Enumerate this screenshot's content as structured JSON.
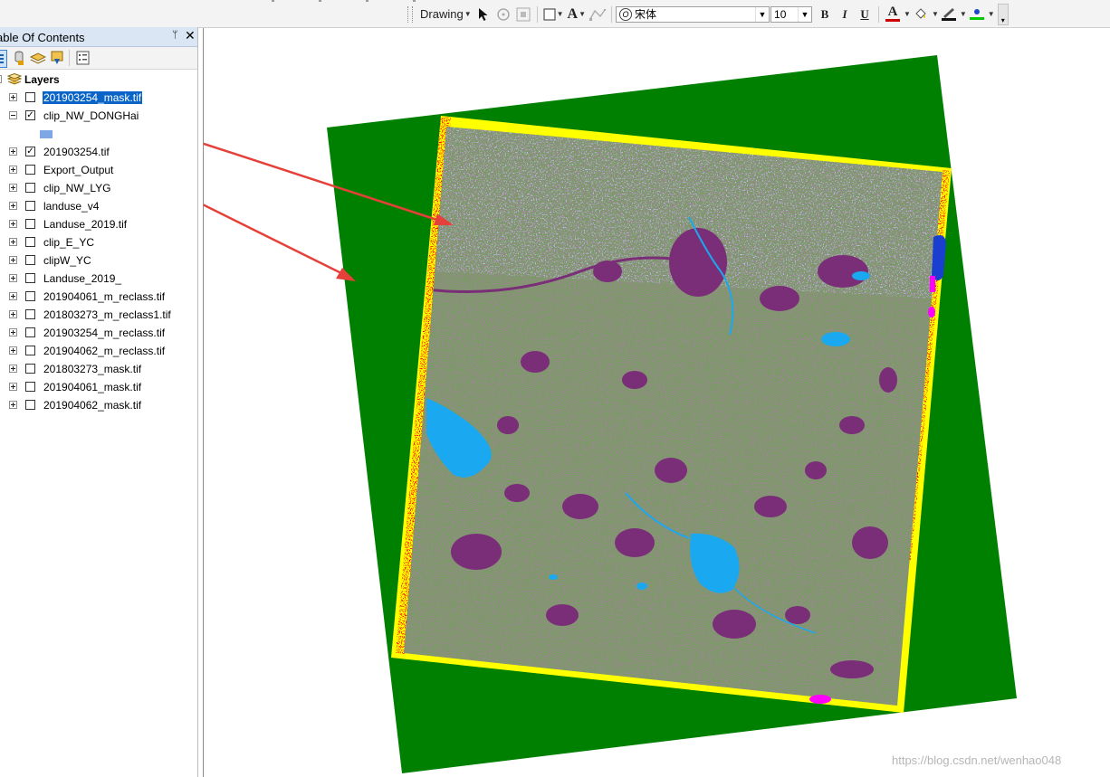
{
  "toolbar": {
    "drawing_label": "Drawing",
    "font_name": "宋体",
    "font_size": "10",
    "bold_label": "B",
    "italic_label": "I",
    "underline_label": "U",
    "font_color_label": "A",
    "text_tool_label": "A",
    "colors": {
      "font": "#cc0000",
      "fill": "#e8c300",
      "line": "#00cc00"
    }
  },
  "toc": {
    "title": "able Of Contents",
    "pin_glyph": "ᛘ",
    "close_glyph": "✕",
    "root_label": "Layers",
    "layers": [
      {
        "name": "201903254_mask.tif",
        "checked": false,
        "expanded": false,
        "selected": true
      },
      {
        "name": "clip_NW_DONGHai",
        "checked": true,
        "expanded": true,
        "selected": false,
        "legend_color": "#7ea7e6"
      },
      {
        "name": "201903254.tif",
        "checked": true,
        "expanded": false,
        "selected": false
      },
      {
        "name": "Export_Output",
        "checked": false,
        "expanded": false,
        "selected": false
      },
      {
        "name": "clip_NW_LYG",
        "checked": false,
        "expanded": false,
        "selected": false
      },
      {
        "name": "landuse_v4",
        "checked": false,
        "expanded": false,
        "selected": false
      },
      {
        "name": "Landuse_2019.tif",
        "checked": false,
        "expanded": false,
        "selected": false
      },
      {
        "name": "clip_E_YC",
        "checked": false,
        "expanded": false,
        "selected": false
      },
      {
        "name": "clipW_YC",
        "checked": false,
        "expanded": false,
        "selected": false
      },
      {
        "name": "Landuse_2019_",
        "checked": false,
        "expanded": false,
        "selected": false
      },
      {
        "name": "201904061_m_reclass.tif",
        "checked": false,
        "expanded": false,
        "selected": false
      },
      {
        "name": "201803273_m_reclass1.tif",
        "checked": false,
        "expanded": false,
        "selected": false
      },
      {
        "name": "201903254_m_reclass.tif",
        "checked": false,
        "expanded": false,
        "selected": false
      },
      {
        "name": "201904062_m_reclass.tif",
        "checked": false,
        "expanded": false,
        "selected": false
      },
      {
        "name": "201803273_mask.tif",
        "checked": false,
        "expanded": false,
        "selected": false
      },
      {
        "name": "201904061_mask.tif",
        "checked": false,
        "expanded": false,
        "selected": false
      },
      {
        "name": "201904062_mask.tif",
        "checked": false,
        "expanded": false,
        "selected": false
      }
    ]
  },
  "map": {
    "colors": {
      "mask": "#008000",
      "border": "#ffff00",
      "noise": "#ff0000",
      "farmland": "#7a9a66",
      "urban": "#7a2e78",
      "forest": "#7e8fd8",
      "water": "#1aa9f0",
      "deep_water": "#1a3fd0",
      "magenta": "#ff00ff",
      "arrow": "#e6403a"
    }
  },
  "watermark": "https://blog.csdn.net/wenhao048"
}
